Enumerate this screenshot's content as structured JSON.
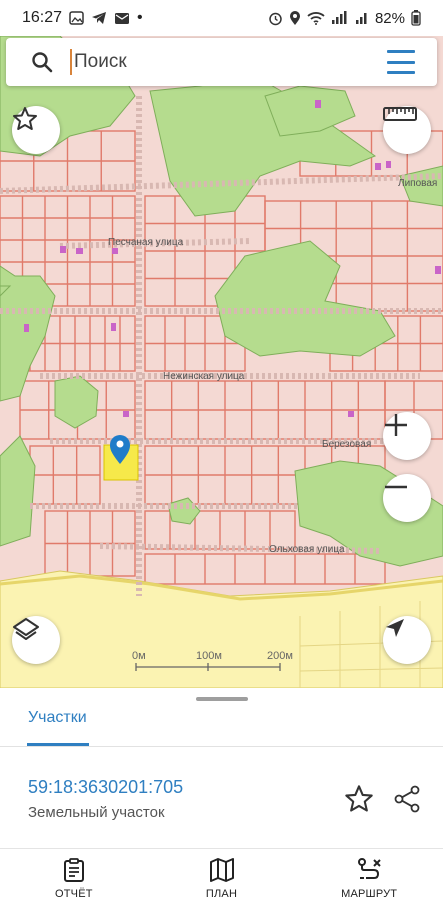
{
  "status_bar": {
    "time": "16:27",
    "battery": "82%"
  },
  "search": {
    "placeholder": "Поиск"
  },
  "map": {
    "streets": [
      "Песчаная улица",
      "Нежинская улица",
      "Березовая",
      "Ольховая улица",
      "Липовая"
    ],
    "scale_labels": [
      "0м",
      "100м",
      "200м"
    ],
    "colors": {
      "parcel_fill": "#f4d9d3",
      "parcel_border": "#e07a6a",
      "forest": "#b5dc8e",
      "road_zone": "#fbf3b2",
      "selected_parcel": "#f6e94a",
      "marker": "#1f7cc9"
    }
  },
  "panel": {
    "tab_label": "Участки",
    "parcel_id": "59:18:3630201:705",
    "parcel_type": "Земельный участок"
  },
  "bottom_nav": {
    "items": [
      {
        "label": "ОТЧЁТ",
        "icon": "report-icon"
      },
      {
        "label": "ПЛАН",
        "icon": "map-plan-icon"
      },
      {
        "label": "МАРШРУТ",
        "icon": "route-icon"
      }
    ]
  }
}
